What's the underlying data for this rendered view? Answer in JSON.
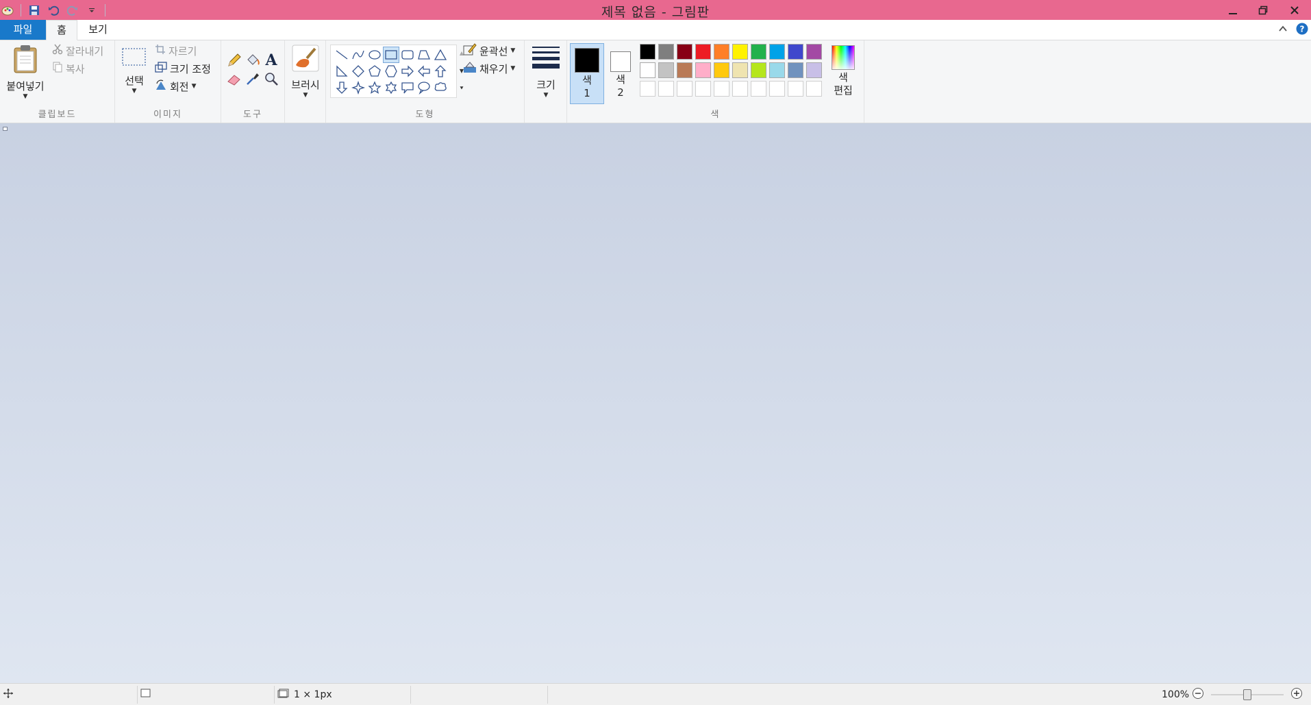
{
  "window": {
    "title": "제목 없음 - 그림판",
    "titlebar_color": "#e8688f"
  },
  "tabs": [
    {
      "label": "파일"
    },
    {
      "label": "홈"
    },
    {
      "label": "보기"
    }
  ],
  "ribbon": {
    "clipboard": {
      "group_label": "클립보드",
      "paste_label": "붙여넣기",
      "cut_label": "잘라내기",
      "copy_label": "복사"
    },
    "image": {
      "group_label": "이미지",
      "select_label": "선택",
      "crop_label": "자르기",
      "resize_label": "크기 조정",
      "rotate_label": "회전"
    },
    "tools": {
      "group_label": "도구"
    },
    "brushes": {
      "label": "브러시"
    },
    "shapes": {
      "group_label": "도형",
      "outline_label": "윤곽선",
      "fill_label": "채우기"
    },
    "size": {
      "label": "크기"
    },
    "colors": {
      "group_label": "색",
      "color1_label": "색",
      "color1_num": "1",
      "color2_label": "색",
      "color2_num": "2",
      "edit_label_1": "색",
      "edit_label_2": "편집",
      "color1_value": "#000000",
      "color2_value": "#ffffff",
      "palette_row1": [
        "#000000",
        "#7f7f7f",
        "#880015",
        "#ed1c24",
        "#ff7f27",
        "#fff200",
        "#22b14c",
        "#00a2e8",
        "#3f48cc",
        "#a349a4"
      ],
      "palette_row2": [
        "#ffffff",
        "#c3c3c3",
        "#b97a57",
        "#ffaec9",
        "#ffc90e",
        "#efe4b0",
        "#b5e61d",
        "#99d9ea",
        "#7092be",
        "#c8bfe7"
      ]
    }
  },
  "statusbar": {
    "selection_size": "1 × 1px",
    "zoom": "100%",
    "zoom_level": 0.5
  }
}
